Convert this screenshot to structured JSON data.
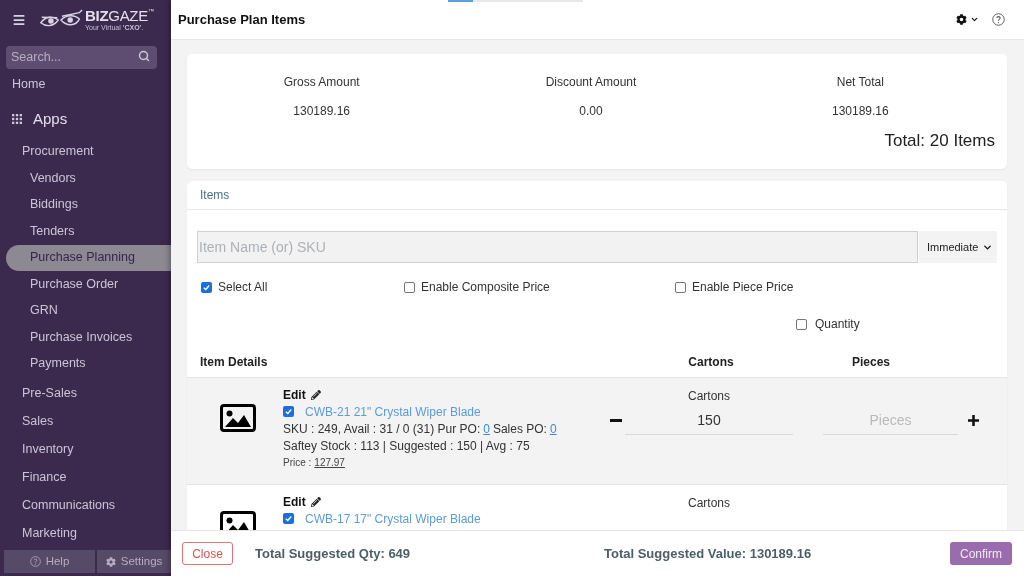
{
  "sidebar": {
    "logo": {
      "name": "**BIZ**GAZE",
      "trademark": "™",
      "tagline": "Your Virtual **'CXO'**."
    },
    "search": {
      "placeholder": "Search..."
    },
    "items": [
      {
        "label": "Home",
        "kind": "link",
        "selected": false
      },
      {
        "label": "Apps",
        "kind": "section",
        "selected": false,
        "children": [
          {
            "label": "Procurement",
            "kind": "link",
            "selected": false,
            "children": [
              {
                "label": "Vendors",
                "kind": "link",
                "selected": false
              },
              {
                "label": "Biddings",
                "kind": "link",
                "selected": false
              },
              {
                "label": "Tenders",
                "kind": "link",
                "selected": false
              },
              {
                "label": "Purchase Planning",
                "kind": "link",
                "selected": true
              },
              {
                "label": "Purchase Order",
                "kind": "link",
                "selected": false
              },
              {
                "label": "GRN",
                "kind": "link",
                "selected": false
              },
              {
                "label": "Purchase Invoices",
                "kind": "link",
                "selected": false
              },
              {
                "label": "Payments",
                "kind": "link",
                "selected": false
              }
            ]
          },
          {
            "label": "Pre-Sales",
            "kind": "link",
            "selected": false
          },
          {
            "label": "Sales",
            "kind": "link",
            "selected": false
          },
          {
            "label": "Inventory",
            "kind": "link",
            "selected": false
          },
          {
            "label": "Finance",
            "kind": "link",
            "selected": false
          },
          {
            "label": "Communications",
            "kind": "link",
            "selected": false
          },
          {
            "label": "Marketing",
            "kind": "link",
            "selected": false
          }
        ]
      }
    ],
    "footer_buttons": [
      {
        "label": "Help",
        "kind": "help"
      },
      {
        "label": "Settings",
        "kind": "settings"
      }
    ]
  },
  "header": {
    "title": "Purchase Plan Items"
  },
  "summary": {
    "metrics": [
      {
        "label": "Gross Amount",
        "value": "130189.16"
      },
      {
        "label": "Discount Amount",
        "value": "0.00"
      },
      {
        "label": "Net Total",
        "value": "130189.16"
      }
    ],
    "total": "Total: 20 Items"
  },
  "items_panel": {
    "title": "Items",
    "search": {
      "placeholder": "Item Name (or) SKU"
    },
    "mode_select": {
      "value": "Immediate"
    },
    "options": [
      {
        "label": "Select All",
        "checked": true
      },
      {
        "label": "Enable Composite Price",
        "checked": false
      },
      {
        "label": "Enable Piece Price",
        "checked": false
      },
      {
        "label": "Quantity",
        "checked": false
      }
    ],
    "columns": [
      "Item Details",
      "Cartons",
      "Pieces"
    ],
    "rows": [
      {
        "edit": "Edit",
        "checked": true,
        "name": "CWB-21 21\" Crystal Wiper Blade",
        "stock_text": "SKU : 249, Avail : 31 / 0 (31) Pur PO:",
        "pur_po": "0",
        "sales_po_label": "Sales PO:",
        "sales_po": "0",
        "stock_line": "Saftey Stock : 113 | Suggested : 150 | Avg : 75",
        "price_label": "Price :",
        "price": "127.97",
        "cartons_label": "Cartons",
        "cartons": "150",
        "pieces_placeholder": "Pieces"
      },
      {
        "edit": "Edit",
        "checked": true,
        "name": "CWB-17 17\" Crystal Wiper Blade",
        "cartons_label": "Cartons"
      }
    ]
  },
  "footer": {
    "close": "Close",
    "total_qty": "Total Suggested Qty: 649",
    "total_value": "Total Suggested Value: 130189.16",
    "confirm": "Confirm"
  }
}
